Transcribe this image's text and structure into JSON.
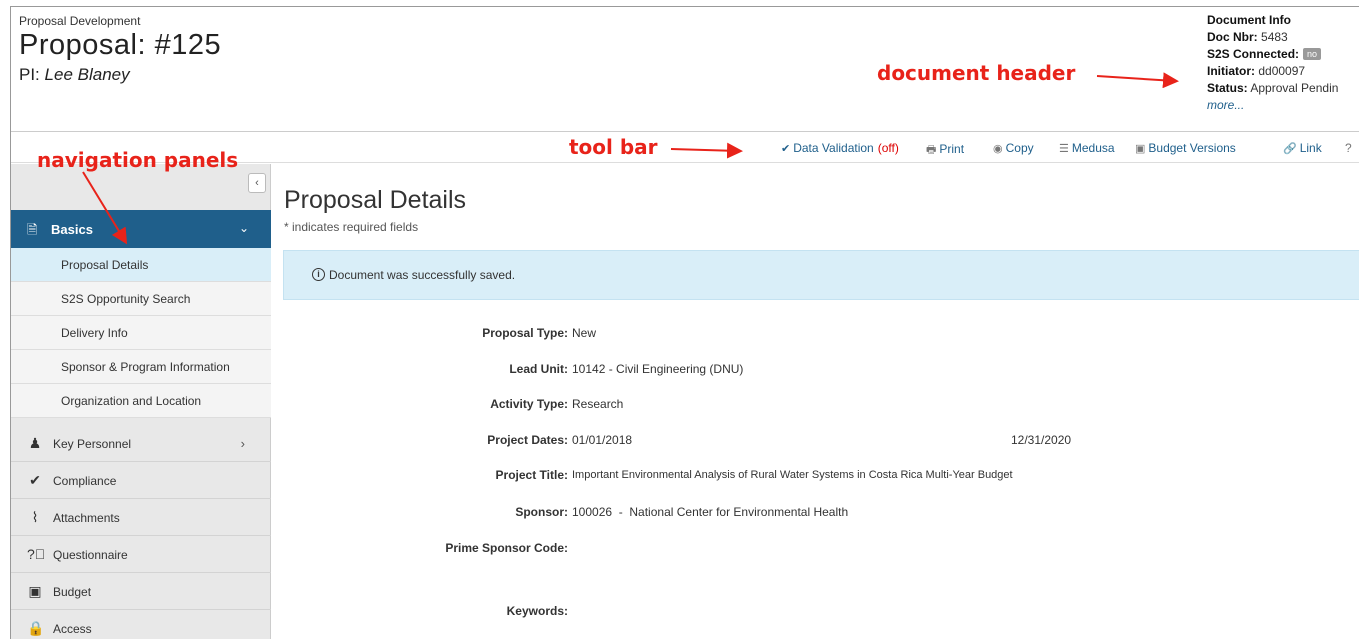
{
  "header": {
    "breadcrumb": "Proposal Development",
    "title": "Proposal: #125",
    "pi_label": "PI:",
    "pi_name": "Lee Blaney"
  },
  "doc_info": {
    "heading": "Document Info",
    "doc_nbr_label": "Doc Nbr:",
    "doc_nbr": "5483",
    "s2s_label": "S2S Connected:",
    "s2s_value": "no",
    "initiator_label": "Initiator:",
    "initiator": "dd00097",
    "status_label": "Status:",
    "status": "Approval Pendin",
    "more": "more..."
  },
  "annotations": {
    "document_header": "document header",
    "tool_bar": "tool bar",
    "navigation_panels": "navigation panels"
  },
  "toolbar": {
    "data_validation": "Data Validation",
    "data_validation_state": "(off)",
    "print": "Print",
    "copy": "Copy",
    "medusa": "Medusa",
    "budget_versions": "Budget Versions",
    "link": "Link",
    "help_partial": "?"
  },
  "sidebar": {
    "collapse_glyph": "‹",
    "active_section": "Basics",
    "sub_items": [
      {
        "label": "Proposal Details"
      },
      {
        "label": "S2S Opportunity Search"
      },
      {
        "label": "Delivery Info"
      },
      {
        "label": "Sponsor & Program Information"
      },
      {
        "label": "Organization and Location"
      }
    ],
    "items": [
      {
        "label": "Key Personnel",
        "icon": "person-icon"
      },
      {
        "label": "Compliance",
        "icon": "check-icon"
      },
      {
        "label": "Attachments",
        "icon": "paperclip-icon"
      },
      {
        "label": "Questionnaire",
        "icon": "question-circle-icon"
      },
      {
        "label": "Budget",
        "icon": "money-icon"
      },
      {
        "label": "Access",
        "icon": "lock-icon"
      }
    ]
  },
  "main": {
    "title": "Proposal Details",
    "required_note": "* indicates required fields",
    "alert": "Document was successfully saved.",
    "fields": {
      "proposal_type": {
        "label": "Proposal Type:",
        "value": "New"
      },
      "lead_unit": {
        "label": "Lead Unit:",
        "value": "10142 - Civil Engineering (DNU)"
      },
      "activity_type": {
        "label": "Activity Type:",
        "value": "Research"
      },
      "project_dates": {
        "label": "Project Dates:",
        "start": "01/01/2018",
        "end": "12/31/2020"
      },
      "project_title": {
        "label": "Project Title:",
        "value": "Important Environmental Analysis of Rural Water Systems in Costa Rica Multi-Year Budget"
      },
      "sponsor": {
        "label": "Sponsor:",
        "value": "100026  -  National Center for Environmental Health"
      },
      "prime_sponsor_code": {
        "label": "Prime Sponsor Code:",
        "value": ""
      },
      "keywords": {
        "label": "Keywords:",
        "value": ""
      }
    }
  },
  "colors": {
    "accent": "#1f5f8b",
    "annotation": "#e8231a",
    "alert_bg": "#d9eef8"
  }
}
